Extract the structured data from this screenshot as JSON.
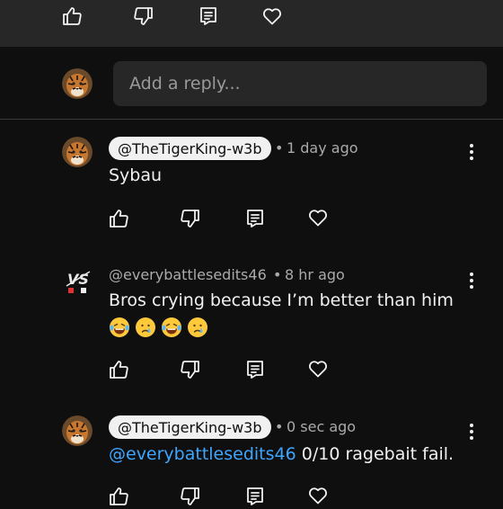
{
  "reply_input": {
    "placeholder": "Add a reply..."
  },
  "comments": [
    {
      "author": "@TheTigerKing-w3b",
      "separator": "•",
      "time": "1 day ago",
      "text": "Sybau"
    },
    {
      "author": "@everybattlesedits46",
      "separator": "•",
      "time": "8 hr ago",
      "text": "Bros crying because I’m better than him",
      "emojis": [
        "laughing-tears",
        "crying-face",
        "laughing-tears",
        "crying-face"
      ]
    },
    {
      "author": "@TheTigerKing-w3b",
      "separator": "•",
      "time": "0 sec ago",
      "mention": "@everybattlesedits46",
      "text": "0/10 ragebait fail."
    }
  ],
  "icons": [
    "thumbs-up-icon",
    "thumbs-down-icon",
    "reply-icon",
    "heart-icon",
    "more-vertical-icon"
  ],
  "colors": {
    "background": "#0f0f0f",
    "surface": "#272727",
    "mention": "#3ea6ff",
    "text": "#f1f1f1",
    "secondary": "#aaaaaa"
  }
}
